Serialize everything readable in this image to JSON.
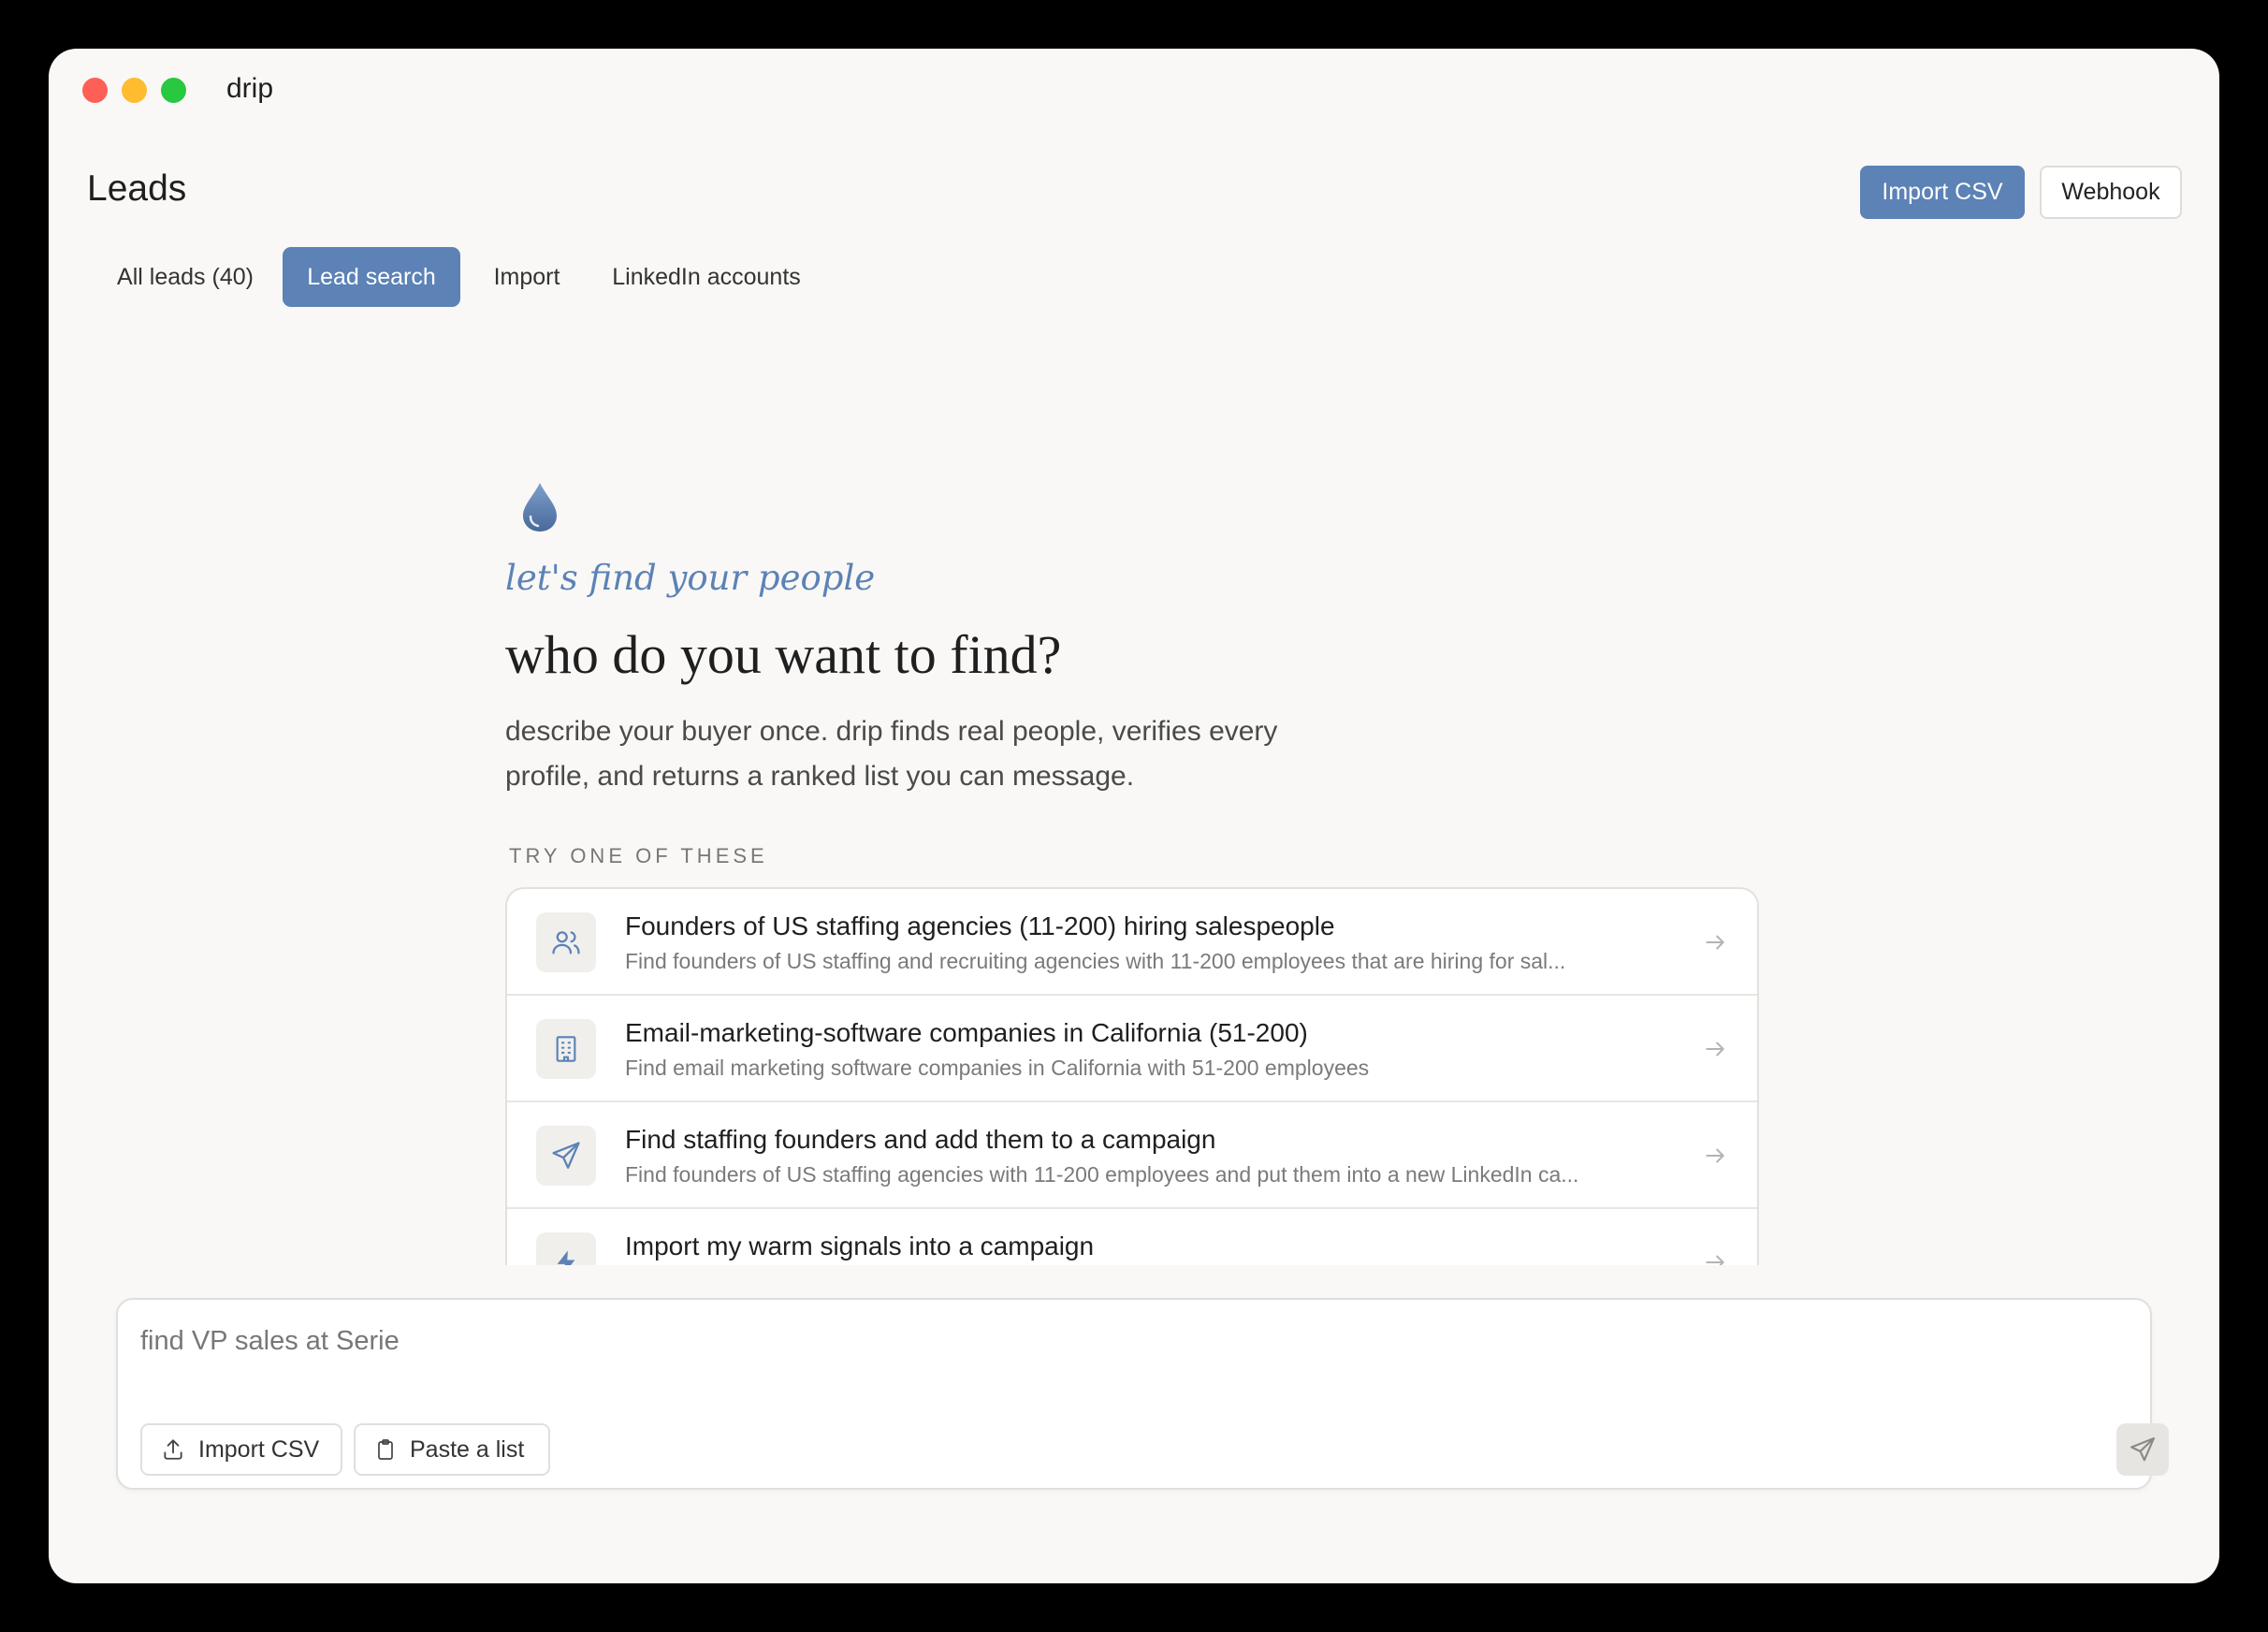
{
  "app": {
    "name": "drip"
  },
  "header": {
    "title": "Leads",
    "import_csv_label": "Import CSV",
    "webhook_label": "Webhook"
  },
  "tabs": [
    {
      "label": "All leads (40)",
      "active": false
    },
    {
      "label": "Lead search",
      "active": true
    },
    {
      "label": "Import",
      "active": false
    },
    {
      "label": "LinkedIn accounts",
      "active": false
    }
  ],
  "hero": {
    "icon": "drop-icon",
    "tagline": "let's find your people",
    "headline": "who do you want to find?",
    "description": "describe your buyer once. drip finds real people, verifies every profile, and returns a ranked list you can message."
  },
  "suggestions": {
    "section_label": "TRY ONE OF THESE",
    "items": [
      {
        "icon": "users-icon",
        "title": "Founders of US staffing agencies (11-200) hiring salespeople",
        "subtitle": "Find founders of US staffing and recruiting agencies with 11-200 employees that are hiring for sal..."
      },
      {
        "icon": "building-icon",
        "title": "Email-marketing-software companies in California (51-200)",
        "subtitle": "Find email marketing software companies in California with 51-200 employees"
      },
      {
        "icon": "send-icon",
        "title": "Find staffing founders and add them to a campaign",
        "subtitle": "Find founders of US staffing agencies with 11-200 employees and put them into a new LinkedIn ca..."
      },
      {
        "icon": "bolt-icon",
        "title": "Import my warm signals into a campaign",
        "subtitle": ""
      }
    ]
  },
  "composer": {
    "value": "find VP sales at Serie",
    "import_csv_label": "Import CSV",
    "paste_list_label": "Paste a list"
  },
  "colors": {
    "accent": "#5c82b6",
    "background": "#f9f8f6"
  }
}
